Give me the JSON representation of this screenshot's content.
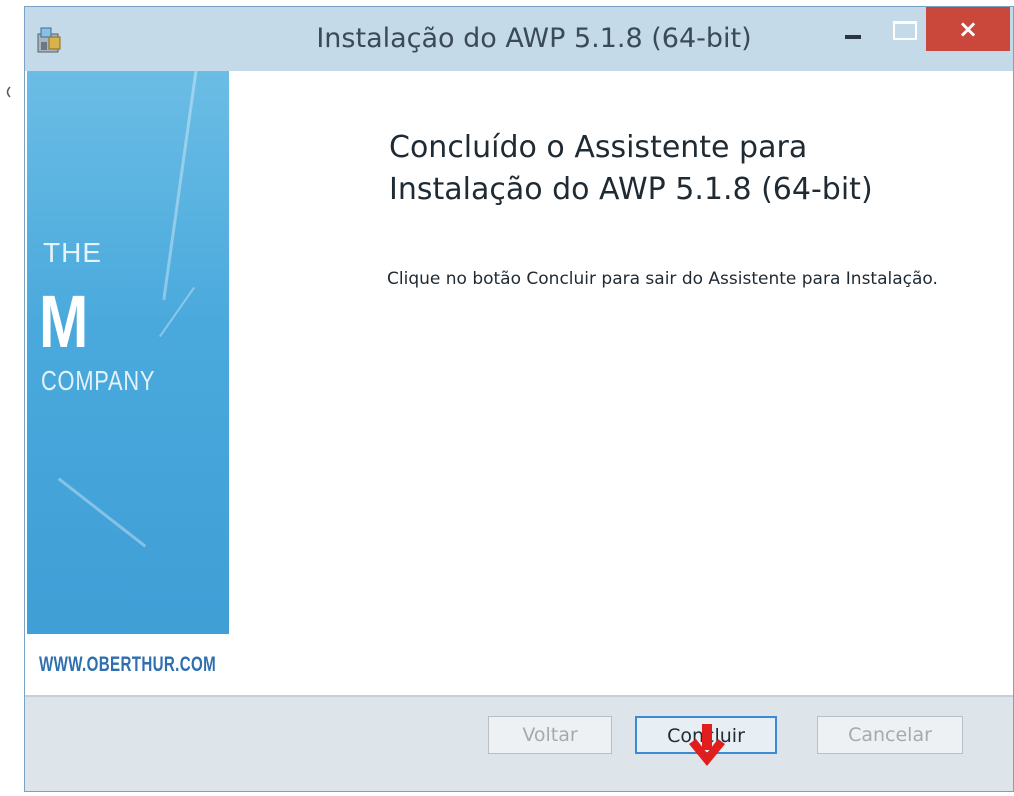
{
  "window": {
    "title": "Instalação do AWP 5.1.8 (64-bit)",
    "close_symbol": "×"
  },
  "banner": {
    "brand_the": "THE",
    "brand_m": "M",
    "brand_company": "COMPANY",
    "website": "WWW.OBERTHUR.COM"
  },
  "main": {
    "heading": "Concluído o Assistente para Instalação do AWP 5.1.8 (64-bit)",
    "description": "Clique no botão Concluir para sair do Assistente para Instalação."
  },
  "buttons": {
    "back": "Voltar",
    "finish": "Concluir",
    "cancel": "Cancelar"
  },
  "colors": {
    "titlebar": "#c4dae8",
    "close": "#c9483b",
    "banner": "#4aa9dc",
    "arrow": "#e01e1e"
  },
  "icons": [
    "installer-icon",
    "minimize-icon",
    "maximize-icon",
    "close-icon",
    "red-arrow-icon"
  ]
}
